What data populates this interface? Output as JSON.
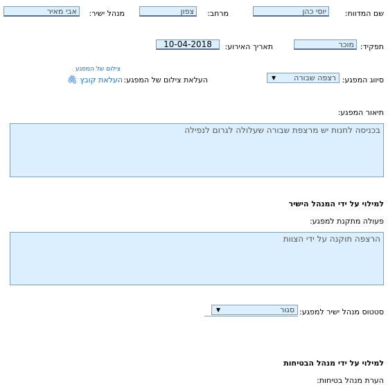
{
  "row1": {
    "auditor_label": "שם המדווח:",
    "auditor_value": "יוסי כהן",
    "region_label": "מרחב:",
    "region_value": "צפון",
    "manager_label": "מנהל ישיר:",
    "manager_value": "אבי מאיר"
  },
  "row2": {
    "role_label": "תפקיד:",
    "role_value": "מוכר",
    "date_label": "תאריך האירוע:",
    "date_value": "10-04-2018"
  },
  "row3": {
    "hazard_type_label": "סיווג המפגע:",
    "hazard_type_value": "רצפה שבורה",
    "upload_label": "העלאת צילום של המפגע:",
    "upload_link": "העלאת קובץ",
    "photo_link": "צילום של המפגע"
  },
  "description": {
    "label": "תיאור המפגע:",
    "value": "בכניסה לחנות יש מרצפת שבורה שעלולה לגרום לנפילה"
  },
  "manager_section": {
    "title": "למילוי על ידי המנהל הישיר",
    "action_label": "פעולה מתקנת למפגע:",
    "action_value": "הרצפה תוקנה על ידי הצוות",
    "status_label": "סטטוס מנהל ישיר למפגע:",
    "status_value": "סגור"
  },
  "safety_section": {
    "title": "למילוי על ידי מנהל הבטיחות",
    "note_label": "הערת מנהל בטיחות:"
  }
}
